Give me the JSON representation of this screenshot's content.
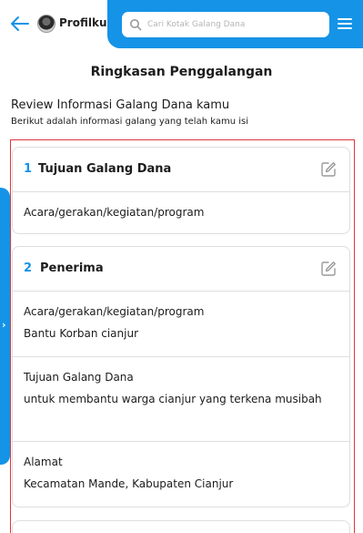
{
  "header": {
    "profile_label": "Profilku",
    "search_placeholder": "Cari Kotak Galang Dana",
    "accent_color": "#1593e6"
  },
  "page": {
    "title": "Ringkasan Penggalangan",
    "review_title": "Review Informasi Galang Dana kamu",
    "review_subtitle": "Berikut adalah informasi galang yang telah kamu isi"
  },
  "cards": [
    {
      "number": "1",
      "title": "Tujuan Galang Dana",
      "sections": [
        {
          "label": "Acara/gerakan/kegiatan/program",
          "value": ""
        }
      ]
    },
    {
      "number": "2",
      "title": "Penerima",
      "sections": [
        {
          "label": "Acara/gerakan/kegiatan/program",
          "value": "Bantu Korban cianjur"
        },
        {
          "label": "Tujuan Galang Dana",
          "value": "untuk membantu warga cianjur yang terkena musibah"
        },
        {
          "label": "Alamat",
          "value": "Kecamatan Mande, Kabupaten Cianjur"
        }
      ]
    }
  ]
}
